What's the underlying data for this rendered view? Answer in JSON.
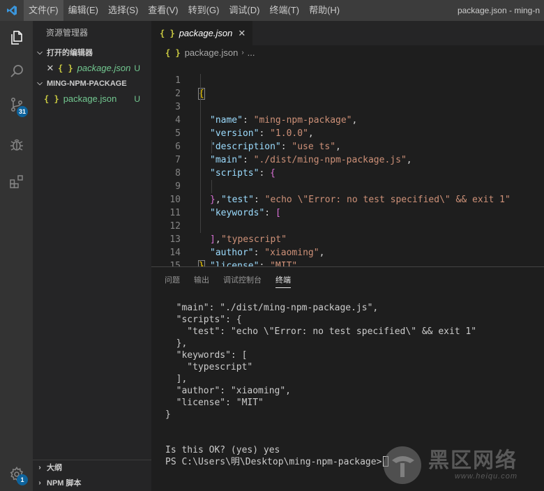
{
  "titlebar": {
    "menu": [
      "文件(F)",
      "编辑(E)",
      "选择(S)",
      "查看(V)",
      "转到(G)",
      "调试(D)",
      "终端(T)",
      "帮助(H)"
    ],
    "window_title": "package.json - ming-n"
  },
  "activitybar": {
    "icons": [
      "explorer-icon",
      "search-icon",
      "source-control-icon",
      "debug-icon",
      "extensions-icon",
      "settings-gear-icon"
    ],
    "scm_badge": "31",
    "settings_badge": "1"
  },
  "sidebar": {
    "title": "资源管理器",
    "open_editors": {
      "label": "打开的编辑器",
      "files": [
        {
          "name": "package.json",
          "status": "U"
        }
      ]
    },
    "project": {
      "label": "MING-NPM-PACKAGE",
      "files": [
        {
          "name": "package.json",
          "status": "U"
        }
      ]
    },
    "outline_label": "大纲",
    "npm_scripts_label": "NPM 脚本"
  },
  "editor": {
    "tab_label": "package.json",
    "breadcrumb": {
      "file": "package.json",
      "rest": "..."
    },
    "json_icon": "{ }",
    "line_numbers": [
      "1",
      "2",
      "3",
      "4",
      "5",
      "6",
      "7",
      "8",
      "9",
      "10",
      "11",
      "12",
      "13",
      "14",
      "15"
    ],
    "code": {
      "open": "{",
      "name_key": "\"name\"",
      "name_val": "\"ming-npm-package\"",
      "version_key": "\"version\"",
      "version_val": "\"1.0.0\"",
      "description_key": "\"description\"",
      "description_val": "\"use ts\"",
      "main_key": "\"main\"",
      "main_val": "\"./dist/ming-npm-package.js\"",
      "scripts_key": "\"scripts\"",
      "scripts_open": "{",
      "test_key": "\"test\"",
      "test_val": "\"echo \\\"Error: no test specified\\\" && exit 1\"",
      "scripts_close": "}",
      "keywords_key": "\"keywords\"",
      "keywords_open": "[",
      "keyword_0": "\"typescript\"",
      "keywords_close": "]",
      "author_key": "\"author\"",
      "author_val": "\"xiaoming\"",
      "license_key": "\"license\"",
      "license_val": "\"MIT\"",
      "close": "}"
    }
  },
  "panel": {
    "tabs": [
      "问题",
      "输出",
      "调试控制台",
      "终端"
    ],
    "active_tab": "终端",
    "terminal_lines": [
      "  \"main\": \"./dist/ming-npm-package.js\",",
      "  \"scripts\": {",
      "    \"test\": \"echo \\\"Error: no test specified\\\" && exit 1\"",
      "  },",
      "  \"keywords\": [",
      "    \"typescript\"",
      "  ],",
      "  \"author\": \"xiaoming\",",
      "  \"license\": \"MIT\"",
      "}",
      "",
      "",
      "Is this OK? (yes) yes",
      "PS C:\\Users\\明\\Desktop\\ming-npm-package>"
    ]
  },
  "watermark": {
    "text": "黑区网络",
    "url": "www.heiqu.com"
  },
  "colors": {
    "accent": "#0e639c",
    "untracked": "#73c991",
    "json_icon": "#cbcb41"
  }
}
